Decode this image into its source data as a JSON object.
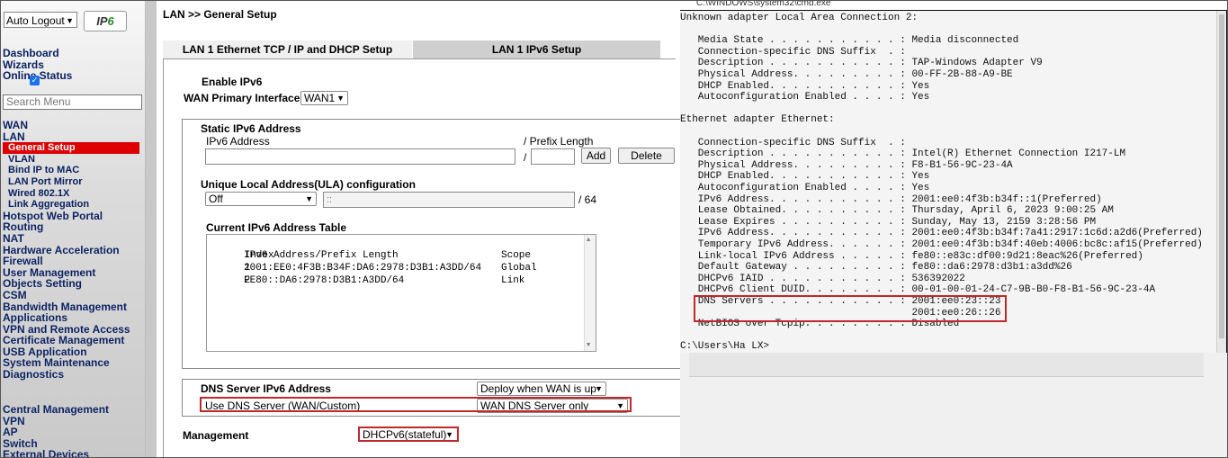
{
  "sidebar": {
    "logout_select": "Auto Logout",
    "logo_prefix": "IP",
    "logo_suffix": "6",
    "top_items": [
      "Dashboard",
      "Wizards",
      "Online Status"
    ],
    "search_placeholder": "Search Menu",
    "wan": "WAN",
    "lan": "LAN",
    "lan_sub": [
      "General Setup",
      "VLAN",
      "Bind IP to MAC",
      "LAN Port Mirror",
      "Wired 802.1X",
      "Link Aggregation"
    ],
    "items": [
      "Hotspot Web Portal",
      "Routing",
      "NAT",
      "Hardware Acceleration",
      "Firewall",
      "User Management",
      "Objects Setting",
      "CSM",
      "Bandwidth Management",
      "Applications",
      "VPN and Remote Access",
      "Certificate Management",
      "USB Application",
      "System Maintenance",
      "Diagnostics"
    ],
    "bottom_items": [
      "Central Management",
      "VPN",
      "AP",
      "Switch",
      "External Devices"
    ]
  },
  "main": {
    "breadcrumb": "LAN >> General Setup",
    "tabs": [
      "LAN 1 Ethernet TCP / IP and DHCP Setup",
      "LAN 1 IPv6 Setup"
    ],
    "enable_ipv6": "Enable IPv6",
    "wan_primary_label": "WAN Primary Interface",
    "wan_primary_value": "WAN1",
    "static_title": "Static IPv6 Address",
    "ipv6_address_label": "IPv6 Address",
    "prefix_label": "/ Prefix Length",
    "slash": "/",
    "add_button": "Add",
    "delete_button": "Delete",
    "ula_title": "Unique Local Address(ULA) configuration",
    "ula_value": "Off",
    "ula_placeholder": "::",
    "ula_suffix": "/ 64",
    "table_title": "Current IPv6 Address Table",
    "table_headers": [
      "Index",
      "IPv6 Address/Prefix Length",
      "Scope"
    ],
    "table_rows": [
      [
        "1",
        "2001:EE0:4F3B:B34F:DA6:2978:D3B1:A3DD/64",
        "Global"
      ],
      [
        "2",
        "FE80::DA6:2978:D3B1:A3DD/64",
        "Link"
      ]
    ],
    "dns_title": "DNS Server IPv6 Address",
    "dns_deploy": "Deploy when WAN is up",
    "use_dns_label": "Use DNS Server (WAN/Custom)",
    "use_dns_value": "WAN DNS Server only",
    "management_label": "Management",
    "management_value": "DHCPv6(stateful)"
  },
  "cmd": {
    "title": "C:\\WINDOWS\\system32\\cmd.exe",
    "lines": [
      "Unknown adapter Local Area Connection 2:",
      "",
      "   Media State . . . . . . . . . . . : Media disconnected",
      "   Connection-specific DNS Suffix  . :",
      "   Description . . . . . . . . . . . : TAP-Windows Adapter V9",
      "   Physical Address. . . . . . . . . : 00-FF-2B-88-A9-BE",
      "   DHCP Enabled. . . . . . . . . . . : Yes",
      "   Autoconfiguration Enabled . . . . : Yes",
      "",
      "Ethernet adapter Ethernet:",
      "",
      "   Connection-specific DNS Suffix  . :",
      "   Description . . . . . . . . . . . : Intel(R) Ethernet Connection I217-LM",
      "   Physical Address. . . . . . . . . : F8-B1-56-9C-23-4A",
      "   DHCP Enabled. . . . . . . . . . . : Yes",
      "   Autoconfiguration Enabled . . . . : Yes",
      "   IPv6 Address. . . . . . . . . . . : 2001:ee0:4f3b:b34f::1(Preferred)",
      "   Lease Obtained. . . . . . . . . . : Thursday, April 6, 2023 9:00:25 AM",
      "   Lease Expires . . . . . . . . . . : Sunday, May 13, 2159 3:28:56 PM",
      "   IPv6 Address. . . . . . . . . . . : 2001:ee0:4f3b:b34f:7a41:2917:1c6d:a2d6(Preferred)",
      "   Temporary IPv6 Address. . . . . . : 2001:ee0:4f3b:b34f:40eb:4006:bc8c:af15(Preferred)",
      "   Link-local IPv6 Address . . . . . : fe80::e83c:df00:9d21:8eac%26(Preferred)",
      "   Default Gateway . . . . . . . . . : fe80::da6:2978:d3b1:a3dd%26",
      "   DHCPv6 IAID . . . . . . . . . . . : 536392022",
      "   DHCPv6 Client DUID. . . . . . . . : 00-01-00-01-24-C7-9B-B0-F8-B1-56-9C-23-4A",
      "   DNS Servers . . . . . . . . . . . : 2001:ee0:23::23",
      "                                       2001:ee0:26::26",
      "   NetBIOS over Tcpip. . . . . . . . : Disabled",
      "",
      "C:\\Users\\Ha LX>"
    ]
  },
  "colors": {
    "highlight_red": "#c0282a",
    "active_menu": "#dd0000",
    "ipv6_logo_green": "#2a8a2a"
  }
}
